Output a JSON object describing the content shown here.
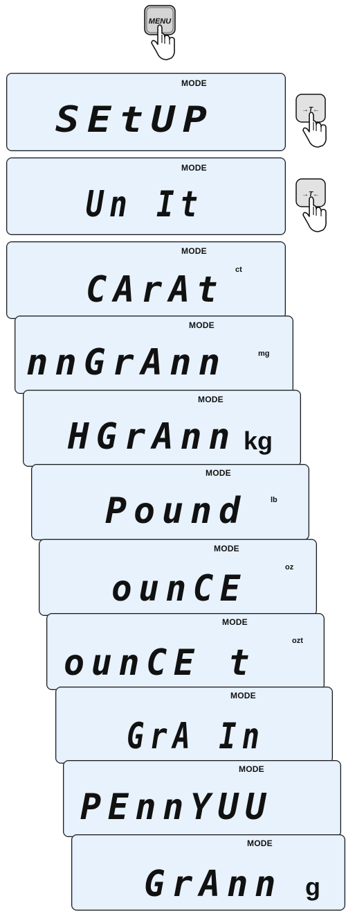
{
  "menu_key": {
    "label": "MENU"
  },
  "tare_key": {
    "label": "→T←"
  },
  "panels": [
    {
      "id": "setup",
      "mode": "MODE",
      "text": "SEtUP",
      "unit": ""
    },
    {
      "id": "unit",
      "mode": "MODE",
      "text": "Un It",
      "unit": ""
    },
    {
      "id": "carat",
      "mode": "MODE",
      "text": "CArAt",
      "unit": "ct"
    },
    {
      "id": "mgram",
      "mode": "MODE",
      "text": "nnGrAnn",
      "unit": "mg"
    },
    {
      "id": "kgram",
      "mode": "MODE",
      "text": "HGrAnn",
      "unit": "kg"
    },
    {
      "id": "pound",
      "mode": "MODE",
      "text": "Pound",
      "unit": "lb"
    },
    {
      "id": "ounce",
      "mode": "MODE",
      "text": "ounCE",
      "unit": "oz"
    },
    {
      "id": "ounce-t",
      "mode": "MODE",
      "text": "ounCE t",
      "unit": "ozt"
    },
    {
      "id": "grain",
      "mode": "MODE",
      "text": "GrA In",
      "unit": ""
    },
    {
      "id": "pennywt",
      "mode": "MODE",
      "text": "PEnnYUU",
      "unit": ""
    },
    {
      "id": "gram",
      "mode": "MODE",
      "text": "GrAnn",
      "unit": "g"
    }
  ]
}
